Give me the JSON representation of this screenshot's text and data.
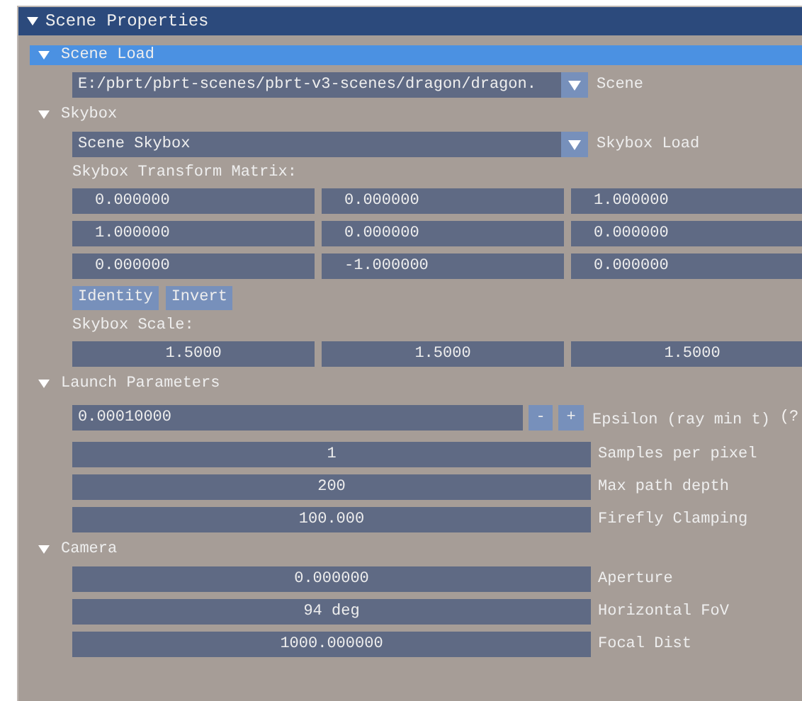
{
  "window": {
    "title": "Scene Properties",
    "expanded": true
  },
  "sections": [
    {
      "title": "Scene Load",
      "selected": true,
      "expanded": true,
      "items": [
        {
          "kind": "combo",
          "value": "E:/pbrt/pbrt-scenes/pbrt-v3-scenes/dragon/dragon.",
          "label": "Scene"
        }
      ]
    },
    {
      "title": "Skybox",
      "selected": false,
      "expanded": true,
      "items": [
        {
          "kind": "combo",
          "value": "Scene Skybox",
          "label": "Skybox Load"
        },
        {
          "kind": "caption",
          "text": "Skybox Transform Matrix:"
        },
        {
          "kind": "matrix_row",
          "values": [
            "0.000000",
            "0.000000",
            "1.000000"
          ]
        },
        {
          "kind": "matrix_row",
          "values": [
            "1.000000",
            "0.000000",
            "0.000000"
          ]
        },
        {
          "kind": "matrix_row",
          "values": [
            "0.000000",
            "-1.000000",
            "0.000000"
          ]
        },
        {
          "kind": "buttons",
          "buttons": [
            "Identity",
            "Invert"
          ]
        },
        {
          "kind": "caption",
          "text": "Skybox Scale:"
        },
        {
          "kind": "scale_row",
          "values": [
            "1.5000",
            "1.5000",
            "1.5000"
          ]
        }
      ]
    },
    {
      "title": "Launch Parameters",
      "selected": false,
      "expanded": true,
      "items": [
        {
          "kind": "stepper",
          "value": "0.00010000",
          "minus": "-",
          "plus": "+",
          "label": "Epsilon (ray min t)",
          "help": "(?"
        },
        {
          "kind": "slider",
          "value": "1",
          "label": "Samples per pixel"
        },
        {
          "kind": "slider",
          "value": "200",
          "label": "Max path depth"
        },
        {
          "kind": "slider",
          "value": "100.000",
          "label": "Firefly Clamping"
        }
      ]
    },
    {
      "title": "Camera",
      "selected": false,
      "expanded": true,
      "items": [
        {
          "kind": "slider",
          "value": "0.000000",
          "label": "Aperture"
        },
        {
          "kind": "slider",
          "value": "94 deg",
          "label": "Horizontal FoV"
        },
        {
          "kind": "slider",
          "value": "1000.000000",
          "label": "Focal Dist"
        }
      ]
    }
  ]
}
